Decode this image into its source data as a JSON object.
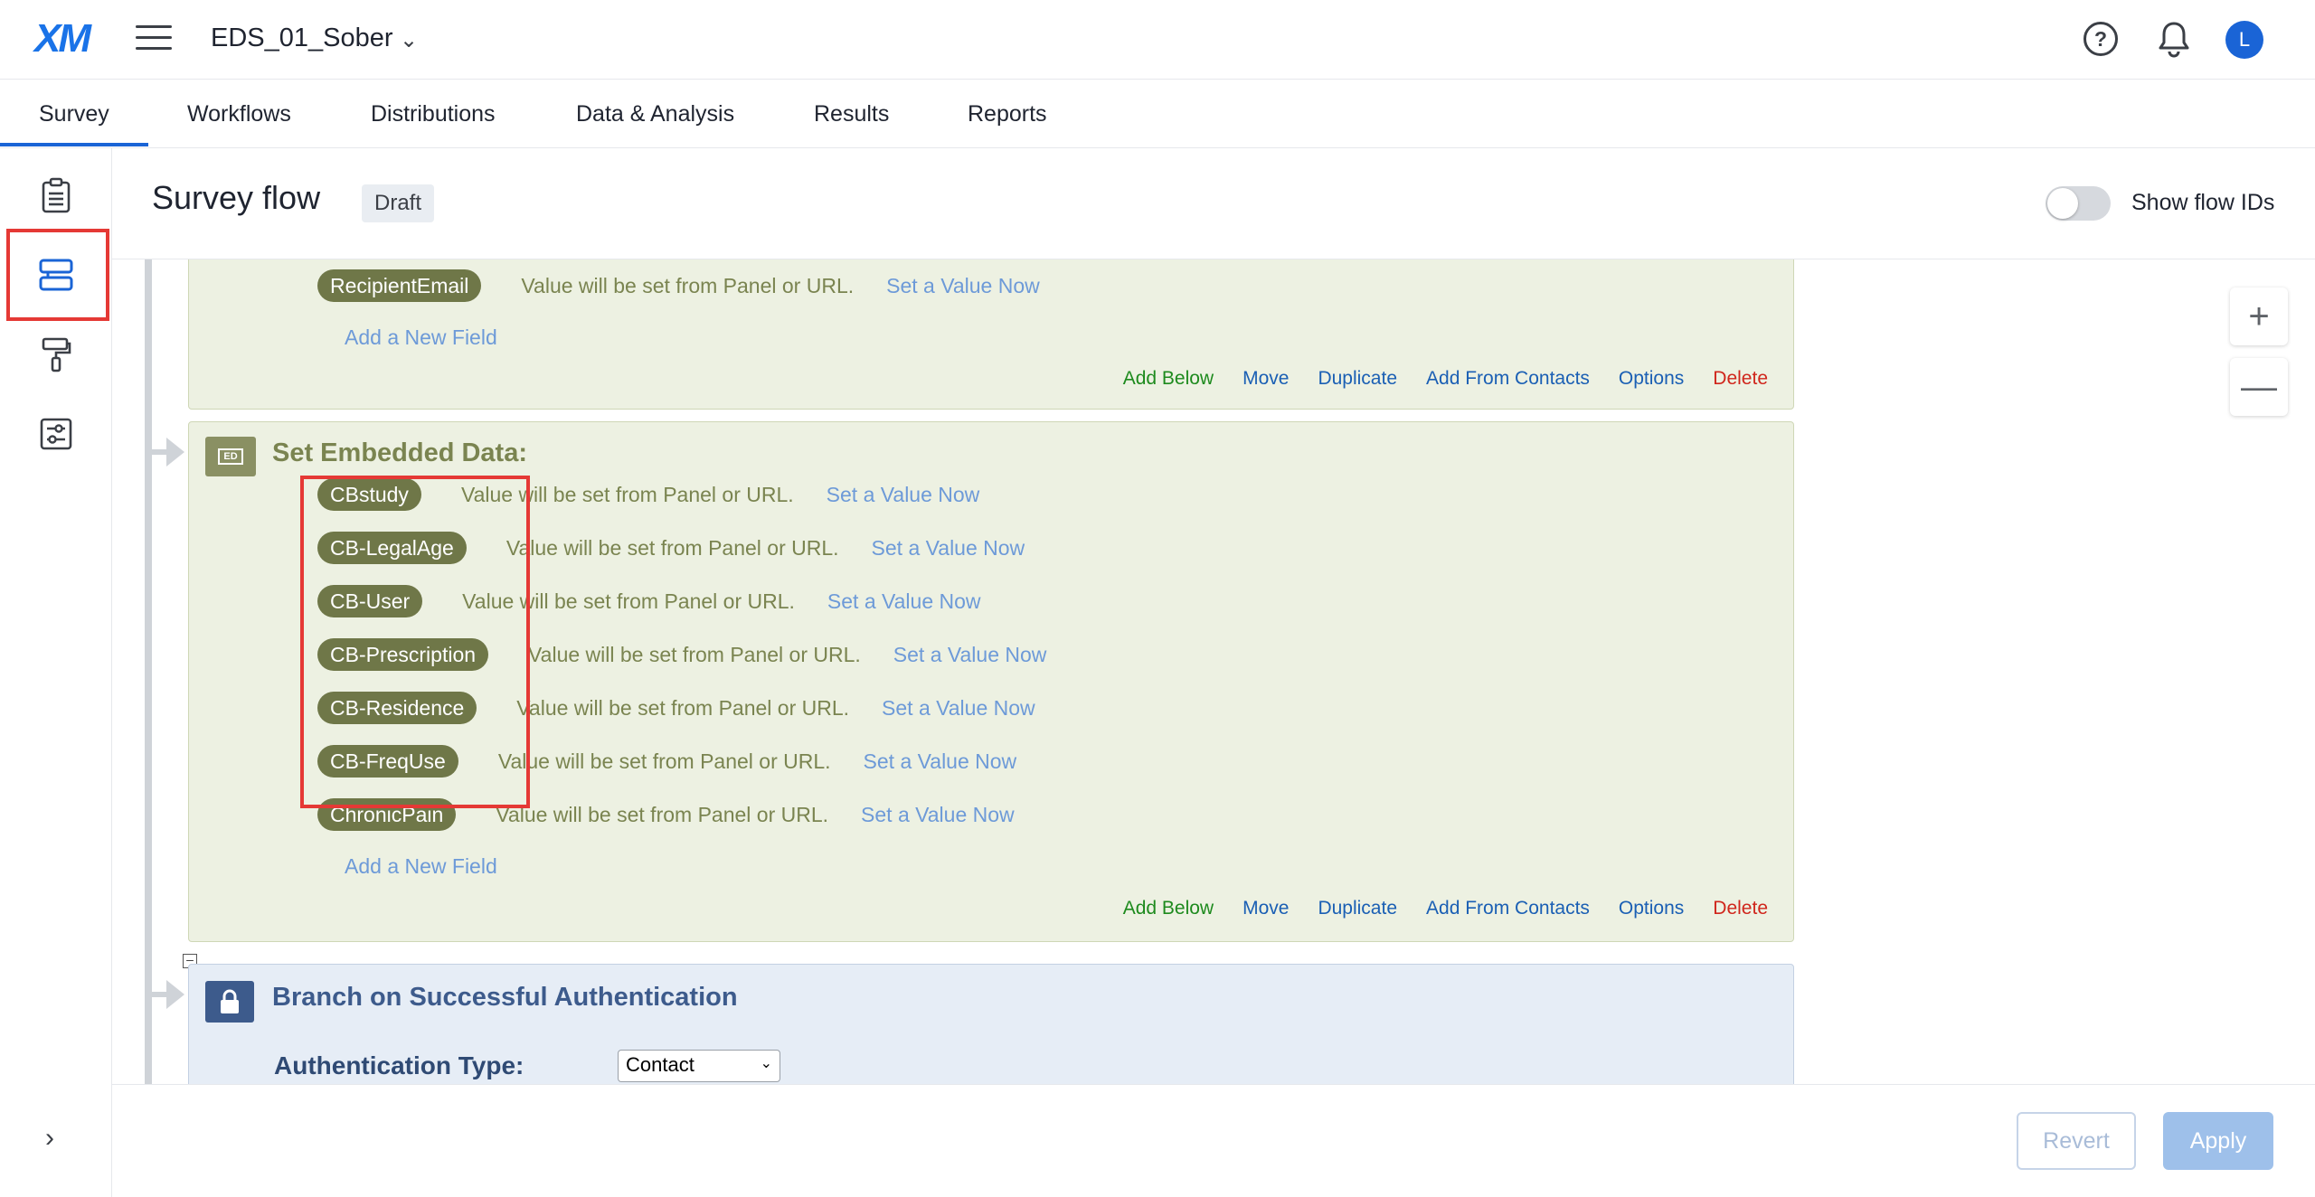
{
  "header": {
    "logo": "XM",
    "project_name": "EDS_01_Sober",
    "avatar_initial": "L"
  },
  "tabs": [
    {
      "label": "Survey"
    },
    {
      "label": "Workflows"
    },
    {
      "label": "Distributions"
    },
    {
      "label": "Data & Analysis"
    },
    {
      "label": "Results"
    },
    {
      "label": "Reports"
    }
  ],
  "page": {
    "title": "Survey flow",
    "status": "Draft",
    "toggle_label": "Show flow IDs"
  },
  "flow": {
    "top_block": {
      "field": {
        "name": "RecipientEmail",
        "value": "Value will be set from Panel or URL.",
        "set_label": "Set a Value Now"
      },
      "add_field": "Add a New Field"
    },
    "embedded_block": {
      "icon_text": "ED",
      "title": "Set Embedded Data:",
      "fields": [
        {
          "name": "CBstudy",
          "value": "Value will be set from Panel or URL.",
          "set_label": "Set a Value Now"
        },
        {
          "name": "CB-LegalAge",
          "value": "Value will be set from Panel or URL.",
          "set_label": "Set a Value Now"
        },
        {
          "name": "CB-User",
          "value": "Value will be set from Panel or URL.",
          "set_label": "Set a Value Now"
        },
        {
          "name": "CB-Prescription",
          "value": "Value will be set from Panel or URL.",
          "set_label": "Set a Value Now"
        },
        {
          "name": "CB-Residence",
          "value": "Value will be set from Panel or URL.",
          "set_label": "Set a Value Now"
        },
        {
          "name": "CB-FreqUse",
          "value": "Value will be set from Panel or URL.",
          "set_label": "Set a Value Now"
        },
        {
          "name": "ChronicPain",
          "value": "Value will be set from Panel or URL.",
          "set_label": "Set a Value Now"
        }
      ],
      "add_field": "Add a New Field"
    },
    "actions": {
      "add_below": "Add Below",
      "move": "Move",
      "duplicate": "Duplicate",
      "add_from_contacts": "Add From Contacts",
      "options": "Options",
      "delete": "Delete"
    },
    "auth_block": {
      "title": "Branch on Successful Authentication",
      "type_label": "Authentication Type:",
      "type_value": "Contact"
    }
  },
  "footer": {
    "revert": "Revert",
    "apply": "Apply"
  }
}
